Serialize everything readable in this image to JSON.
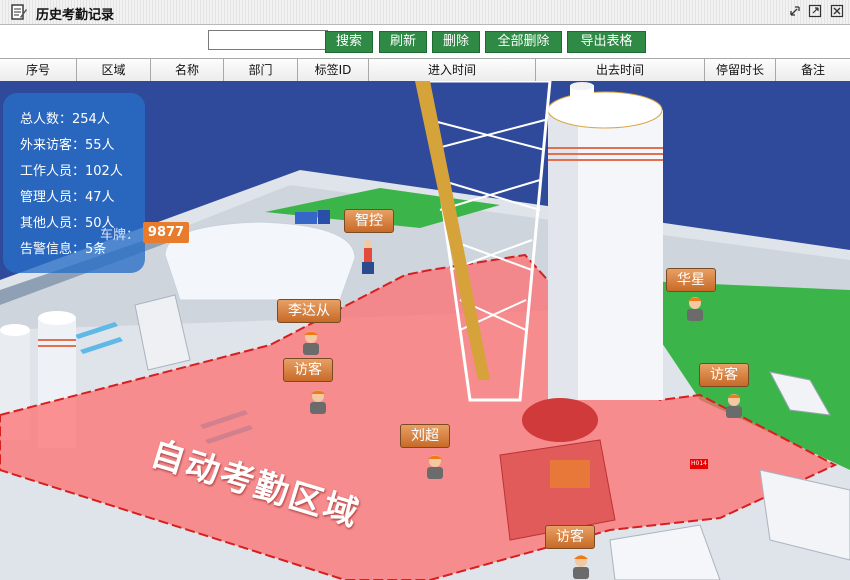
{
  "window": {
    "title": "历史考勤记录"
  },
  "toolbar": {
    "search_value": "",
    "buttons": [
      "搜索",
      "刷新",
      "删除",
      "全部删除",
      "导出表格"
    ]
  },
  "table": {
    "columns": [
      "序号",
      "区域",
      "名称",
      "部门",
      "标签ID",
      "进入时间",
      "出去时间",
      "停留时长",
      "备注"
    ]
  },
  "stats": {
    "rows": [
      {
        "label": "总人数：",
        "value": "254人"
      },
      {
        "label": "外来访客：",
        "value": "55人"
      },
      {
        "label": "工作人员：",
        "value": "102人"
      },
      {
        "label": "管理人员：",
        "value": "47人"
      },
      {
        "label": "其他人员：",
        "value": "50人"
      },
      {
        "label": "告警信息：",
        "value": "5条"
      }
    ]
  },
  "scene": {
    "plate_label": "车牌：",
    "plate_number": "9877",
    "area_label": "自动考勤区域",
    "code_badge": "H014",
    "tags": [
      "智控",
      "李达从",
      "访客",
      "刘超",
      "华星",
      "访客",
      "访客"
    ]
  },
  "colors": {
    "button_green": "#2f8a46",
    "tag_orange": "#d47a3a",
    "zone_red": "#ff6b6b"
  }
}
